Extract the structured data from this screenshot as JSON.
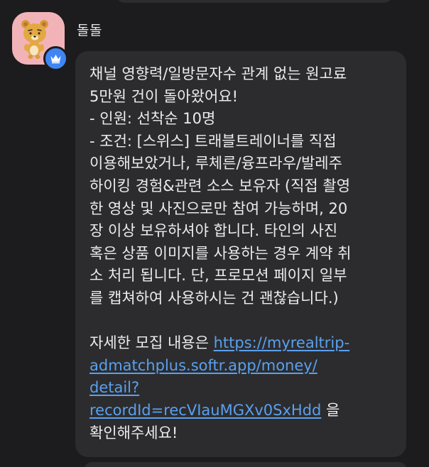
{
  "chat": {
    "sender_name": "돌돌",
    "avatar_icon": "bear-character-avatar",
    "badge_icon": "crown-icon",
    "badge_color": "#3f86f4",
    "message": {
      "line_1": "채널 영향력/일방문자수 관계 없는 원고료",
      "line_2": "5만원 건이 돌아왔어요!",
      "line_3": "- 인원: 선착순 10명",
      "line_4": "- 조건: [스위스] 트래블트레이너를 직접",
      "line_5": "이용해보았거나, 루체른/융프라우/발레주",
      "line_6": "하이킹 경험&관련 소스 보유자 (직접 촬영",
      "line_7": "한 영상 및 사진으로만 참여 가능하며, 20",
      "line_8": "장 이상 보유하셔야 합니다. 타인의 사진",
      "line_9": "혹은 상품 이미지를 사용하는 경우 계약 취",
      "line_10": "소 처리 됩니다. 단, 프로모션 페이지 일부",
      "line_11": "를 캡쳐하여 사용하시는 건 괜찮습니다.)",
      "cta_prefix": "자세한 모집 내용은 ",
      "link_line_1": "https://myrealtrip-",
      "link_line_2": "admatchplus.softr.app/money/",
      "link_line_3": "detail?",
      "link_line_4": "recordId=recVIauMGXv0SxHdd",
      "cta_suffix": " 을",
      "closing": "확인해주세요!"
    },
    "link_color": "#5aa0ee"
  }
}
